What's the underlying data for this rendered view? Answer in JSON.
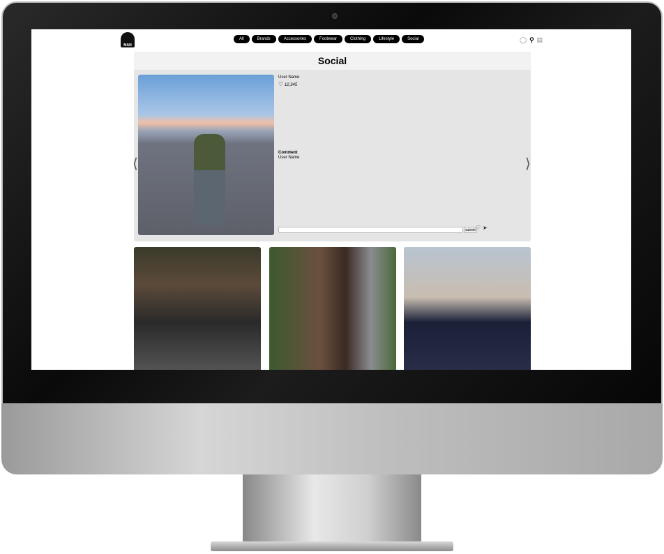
{
  "brand": {
    "logo_text": "MAN"
  },
  "nav": {
    "items": [
      "All",
      "Brands",
      "Accessories",
      "Footwear",
      "Clothing",
      "Lifestyle",
      "Social"
    ]
  },
  "header_icons": [
    "user-icon",
    "search-icon",
    "cart-icon"
  ],
  "page": {
    "title": "Social"
  },
  "post": {
    "user_name": "User Name",
    "likes": "12,345",
    "comment_heading": "Comment",
    "comment_user": "User Name",
    "comment_placeholder": "",
    "submit_label": "submit"
  }
}
